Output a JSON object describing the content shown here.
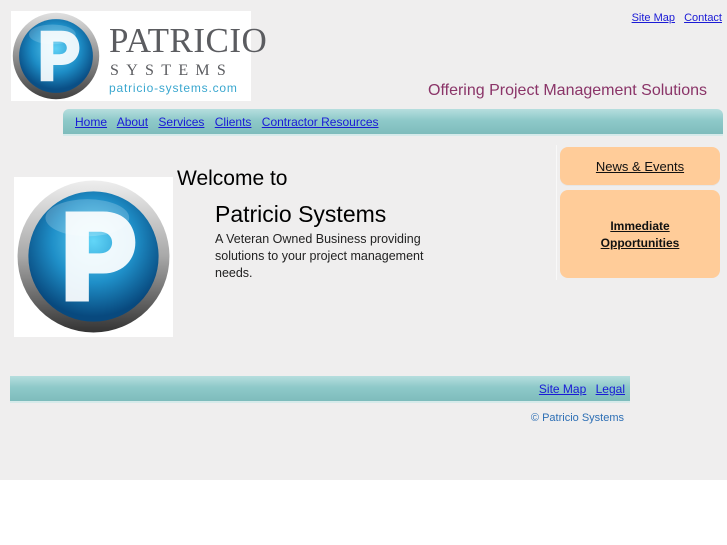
{
  "header": {
    "logo": {
      "name": "PATRICIO",
      "sub": "SYSTEMS",
      "url": "patricio-systems.com"
    },
    "top_links": {
      "sitemap": "Site Map",
      "contact": "Contact"
    },
    "tagline": "Offering Project Management Solutions"
  },
  "nav": {
    "items": [
      "Home",
      "About",
      "Services",
      "Clients",
      "Contractor Resources"
    ]
  },
  "main": {
    "welcome": "Welcome to",
    "company": "Patricio Systems",
    "description": "A Veteran Owned Business providing solutions to your project management needs."
  },
  "sidebar": {
    "news": "News & Events",
    "opps_line1": "Immediate",
    "opps_line2": "Opportunities"
  },
  "footer": {
    "sitemap": "Site Map",
    "legal": "Legal",
    "copyright": "© Patricio Systems"
  },
  "colors": {
    "page_bg": "#efeeee",
    "bar": "#8ec9c9",
    "peach": "#ffcc99",
    "tagline": "#8a3468",
    "link": "#1a1ad6"
  }
}
